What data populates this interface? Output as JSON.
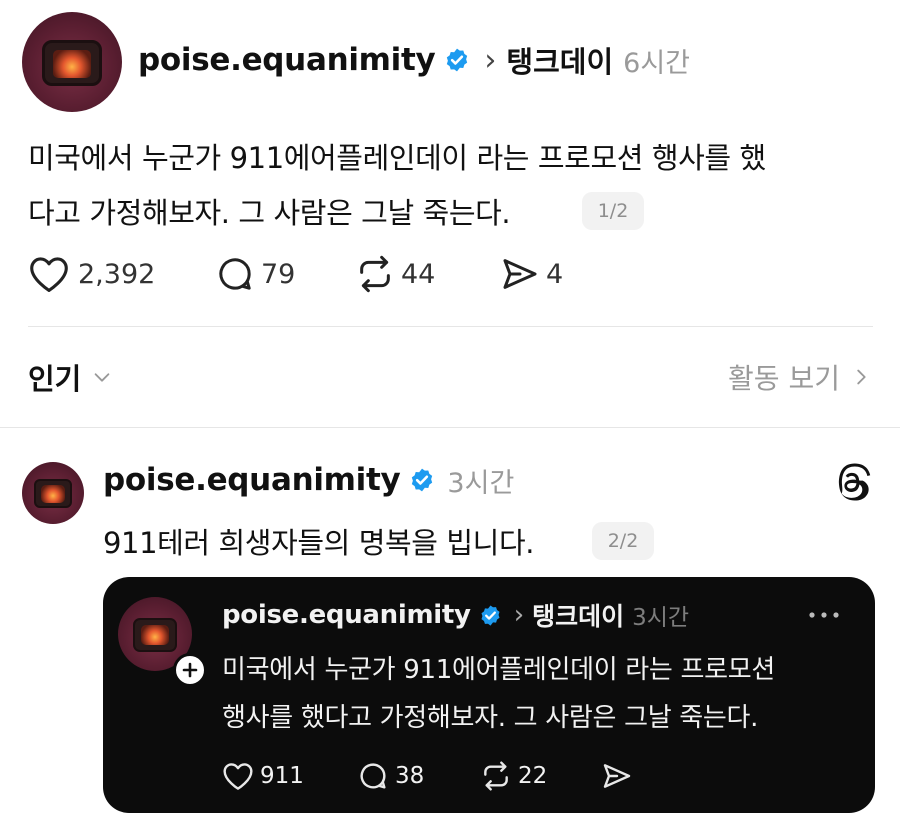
{
  "post": {
    "username": "poise.equanimity",
    "separator": "›",
    "community": "탱크데이",
    "time": "6시간",
    "text_line1": "미국에서 누군가 911에어플레인데이 라는 프로모션 행사를 했",
    "text_line2": "다고 가정해보자. 그 사람은 그날 죽는다.",
    "page_badge": "1/2",
    "likes": "2,392",
    "comments": "79",
    "reposts": "44",
    "shares": "4"
  },
  "sort": {
    "label": "인기",
    "activity_link": "활동 보기"
  },
  "reply": {
    "username": "poise.equanimity",
    "time": "3시간",
    "text": "911테러 희생자들의 명복을 빕니다.",
    "page_badge": "2/2"
  },
  "quoted": {
    "username": "poise.equanimity",
    "separator": "›",
    "community": "탱크데이",
    "time": "3시간",
    "text_line1": "미국에서 누군가 911에어플레인데이 라는 프로모션",
    "text_line2": "행사를 했다고 가정해보자. 그 사람은 그날 죽는다.",
    "likes": "911",
    "comments": "38",
    "reposts": "22"
  },
  "colors": {
    "verified_blue": "#1d9bf0",
    "dark_card_bg": "#0c0c0c",
    "muted_text": "#9a9a9a"
  },
  "icons": [
    "verified-badge-icon",
    "heart-icon",
    "comment-icon",
    "repost-icon",
    "share-icon",
    "chevron-down-icon",
    "chevron-right-icon",
    "threads-logo-icon",
    "more-icon",
    "follow-plus-icon"
  ]
}
